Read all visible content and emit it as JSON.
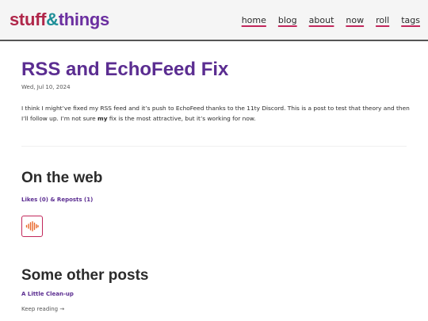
{
  "site": {
    "logo_part1": "stuff",
    "logo_part2": "&",
    "logo_part3": "things"
  },
  "nav": {
    "items": [
      "home",
      "blog",
      "about",
      "now",
      "roll",
      "tags"
    ]
  },
  "post": {
    "title": "RSS and EchoFeed Fix",
    "date": "Wed, Jul 10, 2024",
    "body_part1": "I think I might’ve fixed my RSS feed and it’s push to EchoFeed thanks to the 11ty Discord. This is a post to test that theory and then I’ll follow up. I’m not sure ",
    "body_bold": "my",
    "body_part2": " fix is the most attractive, but it’s working for now."
  },
  "webmentions": {
    "heading": "On the web",
    "summary": "Likes (0) & Reposts (1)",
    "avatar_icon": "audio-waveform-icon",
    "accent": "#e8682a"
  },
  "other_posts": {
    "heading": "Some other posts",
    "items": [
      {
        "title": "A Little Clean-up",
        "cta": "Keep reading →"
      }
    ]
  },
  "colors": {
    "logo_red": "#b0274a",
    "logo_teal": "#1e8f98",
    "logo_purple": "#6b2fa0",
    "accent": "#c2275b",
    "title": "#5b2d91"
  }
}
